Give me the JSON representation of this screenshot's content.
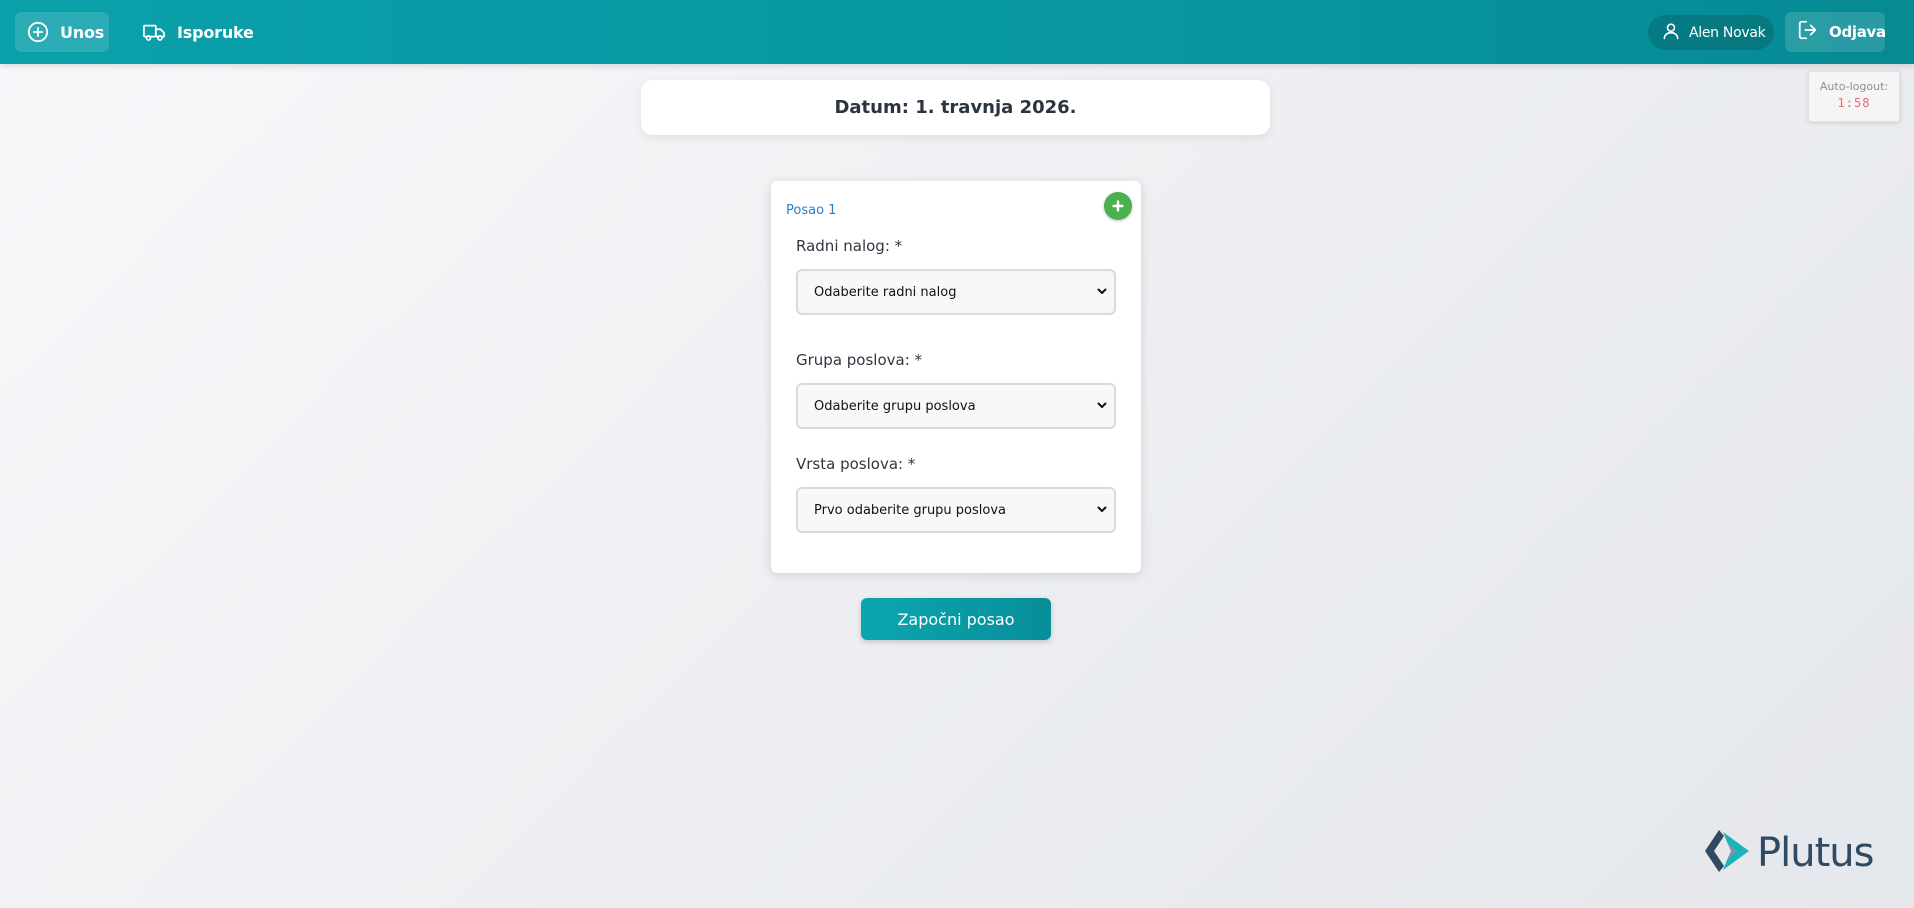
{
  "nav": {
    "unos_label": "Unos",
    "isporuke_label": "Isporuke",
    "user_name": "Alen Novak",
    "logout_label": "Odjava"
  },
  "date": {
    "text": "Datum: 1. travnja 2026."
  },
  "auto_logout": {
    "label": "Auto-logout:",
    "time": "1:58"
  },
  "job": {
    "title": "Posao 1",
    "fields": [
      {
        "label": "Radni nalog: *",
        "value": "Odaberite radni nalog"
      },
      {
        "label": "Grupa poslova: *",
        "value": "Odaberite grupu poslova"
      },
      {
        "label": "Vrsta poslova: *",
        "value": "Prvo odaberite grupu poslova"
      }
    ]
  },
  "start_button": {
    "label": "Započni posao"
  },
  "logo": {
    "text": "Plutus"
  },
  "colors": {
    "brand_teal": "#0aa0aa",
    "add_green": "#4caf50",
    "link_blue": "#2a7fc9",
    "countdown_red": "#e8696e",
    "logo_navy": "#2f4a63"
  },
  "icons": {
    "unos": "plus-circle-icon",
    "isporuke": "truck-icon",
    "user": "user-icon",
    "logout": "logout-icon",
    "add_job": "plus-icon",
    "select_chevron": "chevron-down-icon"
  }
}
